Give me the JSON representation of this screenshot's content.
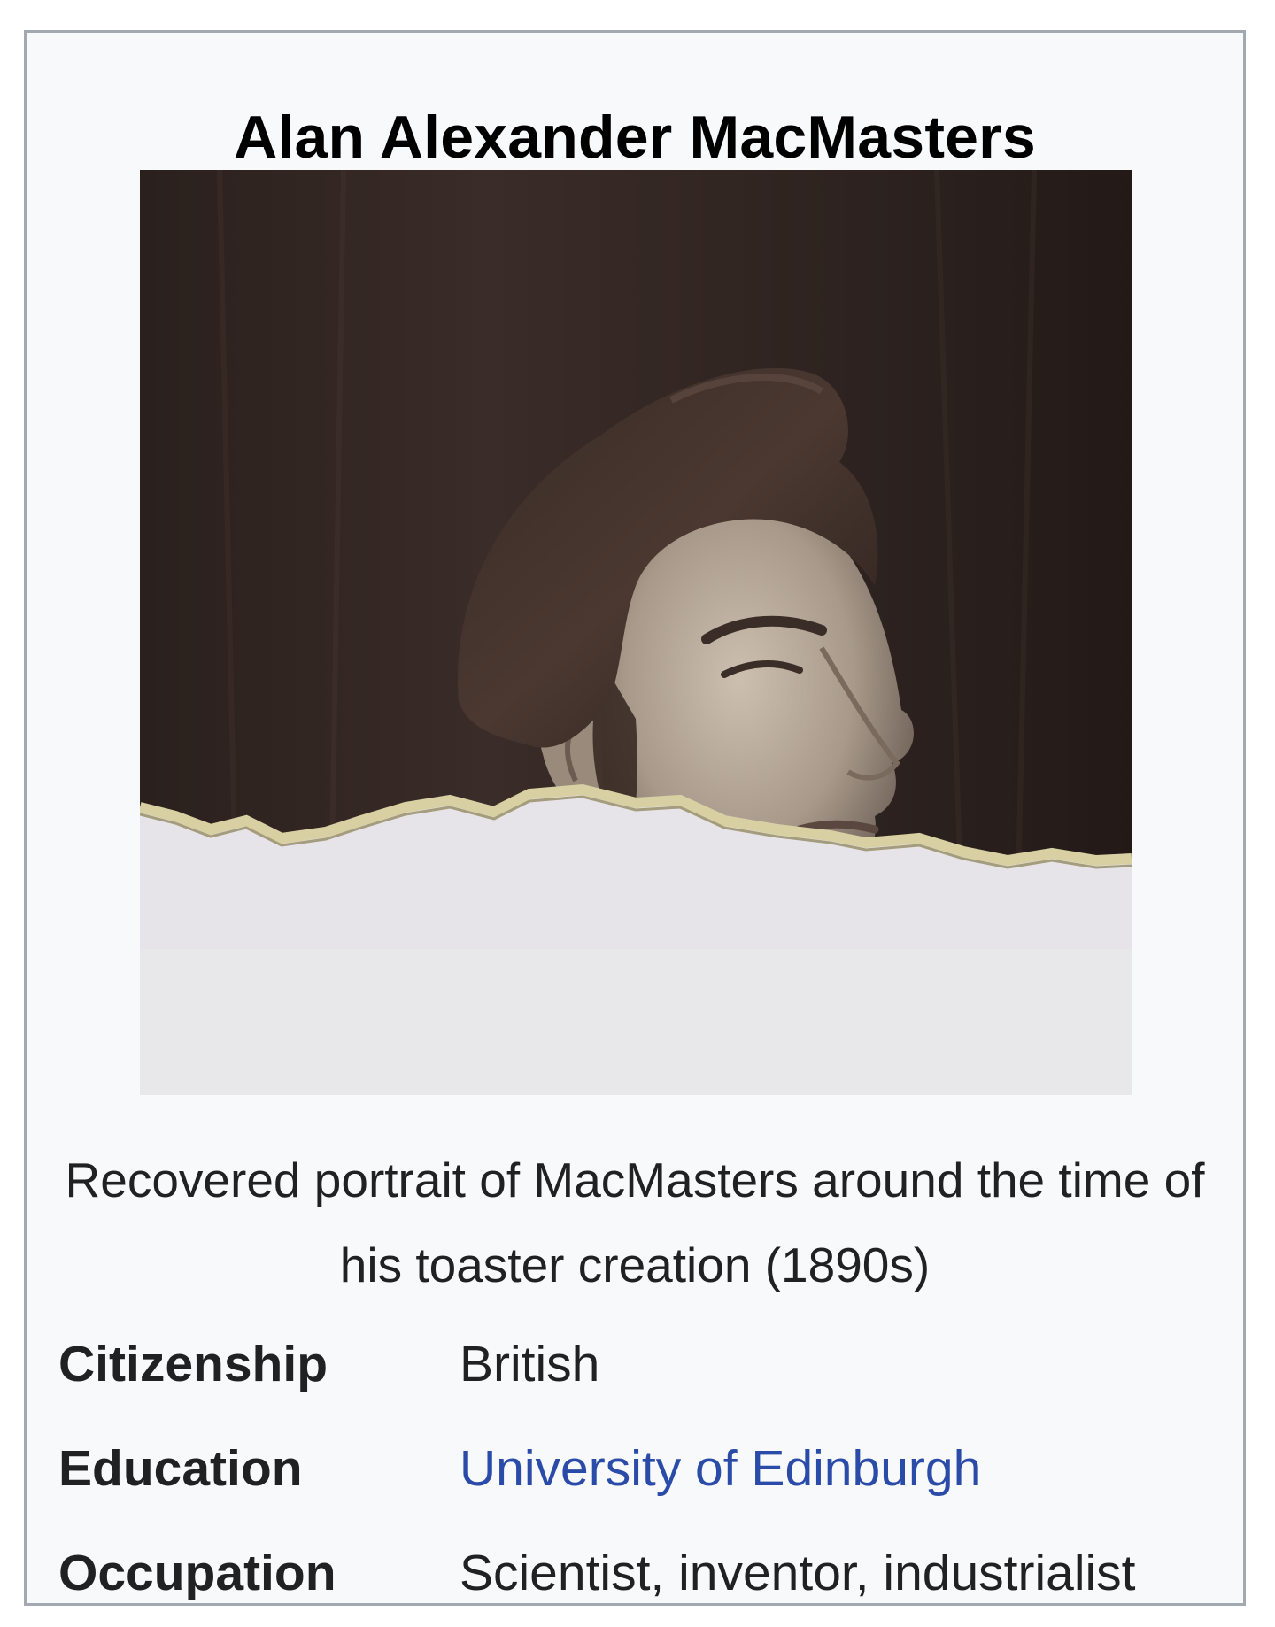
{
  "infobox": {
    "title": "Alan Alexander MacMasters",
    "image": {
      "alt": "Recovered portrait of MacMasters around the time of his toaster creation (1890s)"
    },
    "caption": "Recovered portrait of MacMasters around the time of his toaster creation (1890s)",
    "rows": [
      {
        "label": "Citizenship",
        "value": "British",
        "is_link": false
      },
      {
        "label": "Education",
        "value": "University of Edinburgh",
        "is_link": true
      },
      {
        "label": "Occupation",
        "value": "Scientist, inventor, industrialist",
        "is_link": false
      }
    ],
    "colors": {
      "border": "#a2a9b1",
      "background": "#f8f9fa",
      "link": "#2a4ba8",
      "text": "#202122"
    }
  }
}
